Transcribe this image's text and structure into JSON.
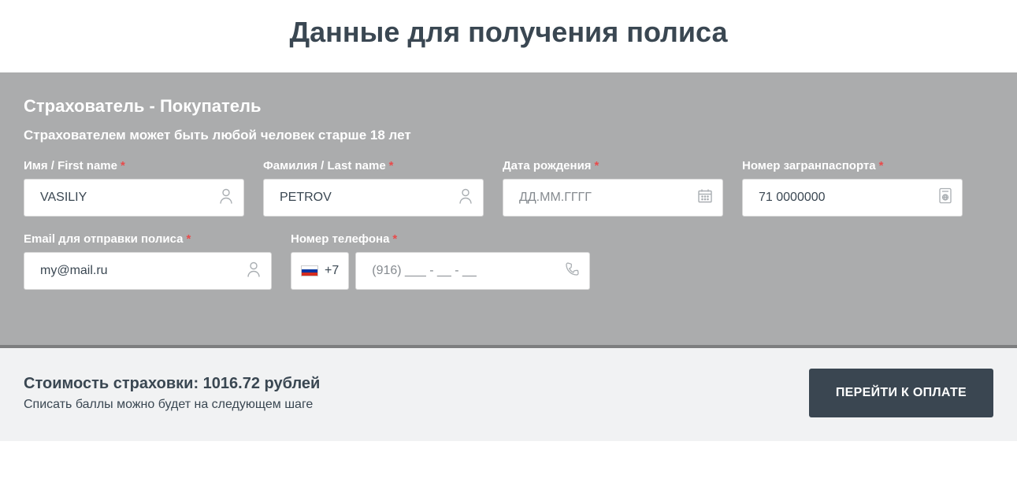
{
  "page_title": "Данные для получения полиса",
  "section": {
    "title": "Страхователь - Покупатель",
    "subtitle": "Страхователем может быть любой человек старше 18 лет"
  },
  "fields": {
    "first_name": {
      "label": "Имя / First name",
      "value": "VASILIY"
    },
    "last_name": {
      "label": "Фамилия / Last name",
      "value": "PETROV"
    },
    "birth_date": {
      "label": "Дата рождения",
      "placeholder": "ДД.ММ.ГГГГ",
      "value": ""
    },
    "passport": {
      "label": "Номер загранпаспорта",
      "value": "71 0000000"
    },
    "email": {
      "label": "Email для отправки полиса",
      "value": "my@mail.ru"
    },
    "phone": {
      "label": "Номер телефона",
      "prefix": "+7",
      "placeholder": "(916) ___ - __ - __",
      "value": ""
    }
  },
  "footer": {
    "price_label": "Стоимость страховки:",
    "price_value": "1016.72",
    "price_currency": "рублей",
    "note": "Списать баллы можно будет на следующем шаге",
    "pay_button": "ПЕРЕЙТИ К ОПЛАТЕ"
  }
}
